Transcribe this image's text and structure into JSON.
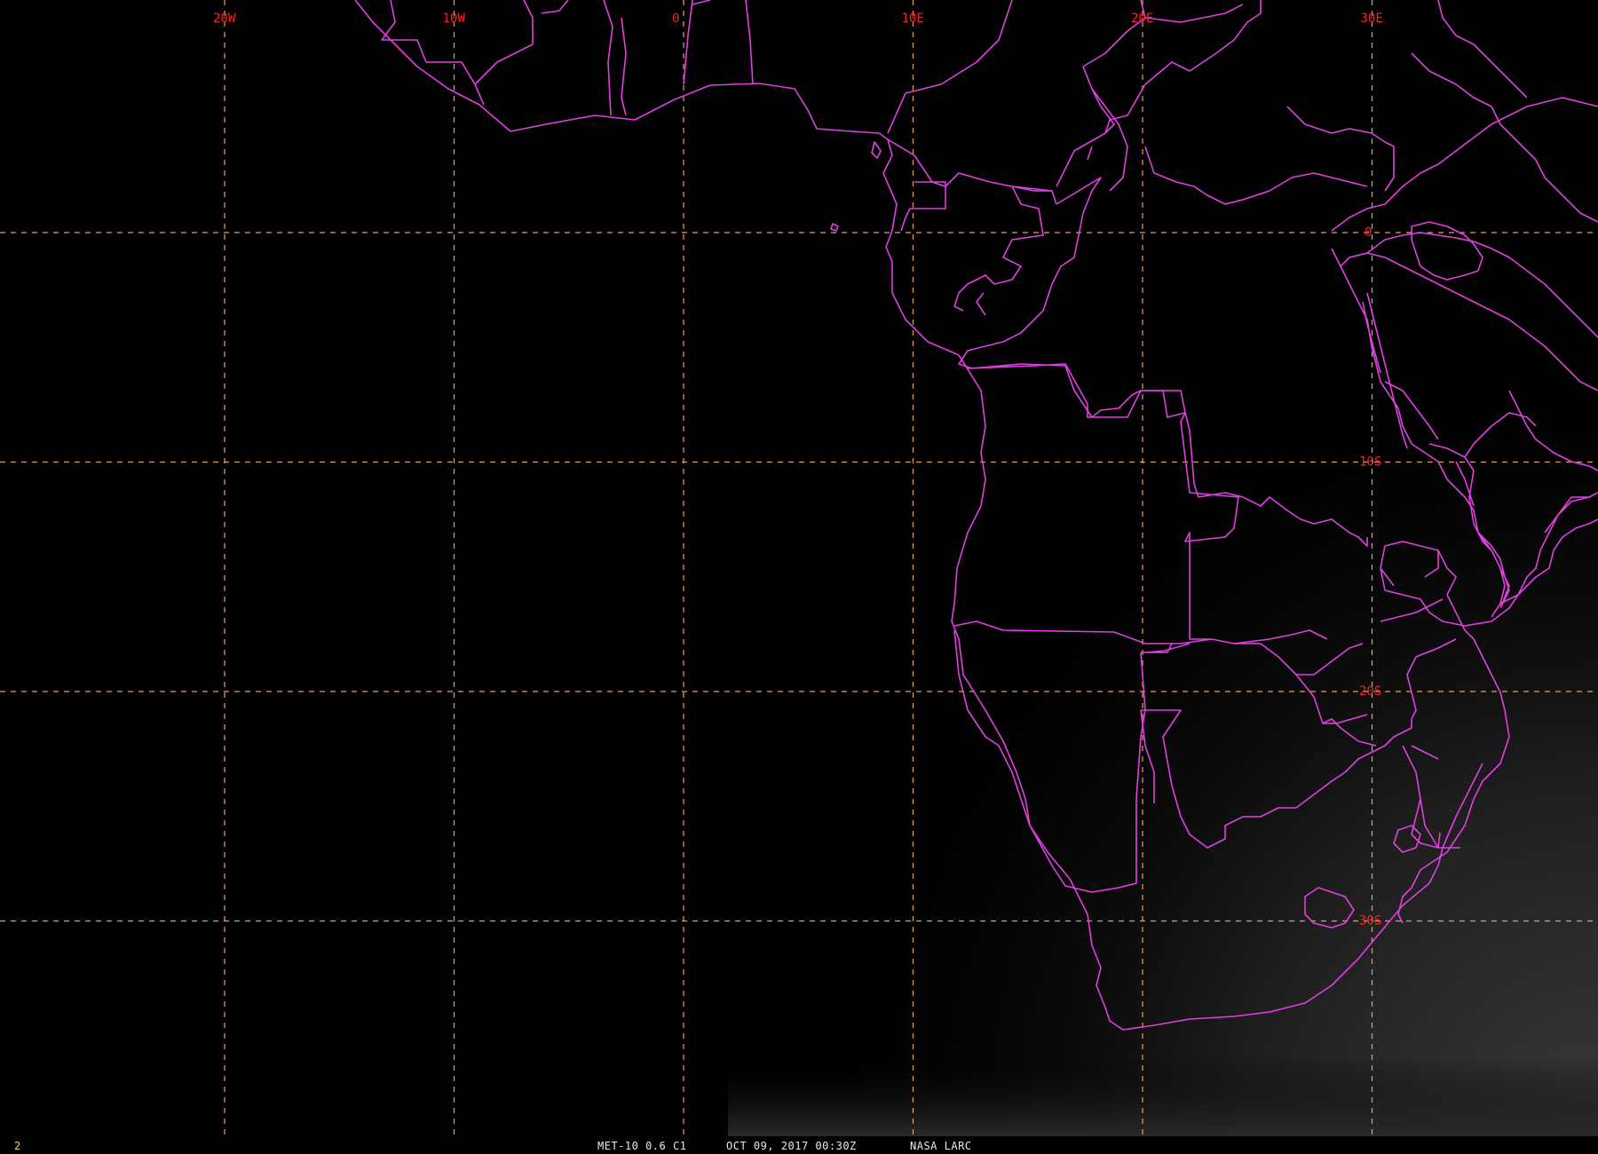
{
  "map": {
    "lon_labels": [
      {
        "lon": -20,
        "text": "20W"
      },
      {
        "lon": -10,
        "text": "10W"
      },
      {
        "lon": 0,
        "text": "0"
      },
      {
        "lon": 10,
        "text": "10E"
      },
      {
        "lon": 20,
        "text": "20E"
      },
      {
        "lon": 30,
        "text": "30E"
      }
    ],
    "lat_labels": [
      {
        "lat": 0,
        "text": "0"
      },
      {
        "lat": -10,
        "text": "10S"
      },
      {
        "lat": -20,
        "text": "20S"
      },
      {
        "lat": -30,
        "text": "30S"
      }
    ],
    "colors": {
      "background": "#000000",
      "borders": "#e040e0",
      "grid": "#e8a060",
      "grid_labels": "#ff2020",
      "frame_number": "#e8e050"
    }
  },
  "status": {
    "frame_number": "2",
    "satellite": "MET-10 0.6 C1",
    "datetime": "OCT 09, 2017 00:30Z",
    "source": "NASA LARC"
  }
}
